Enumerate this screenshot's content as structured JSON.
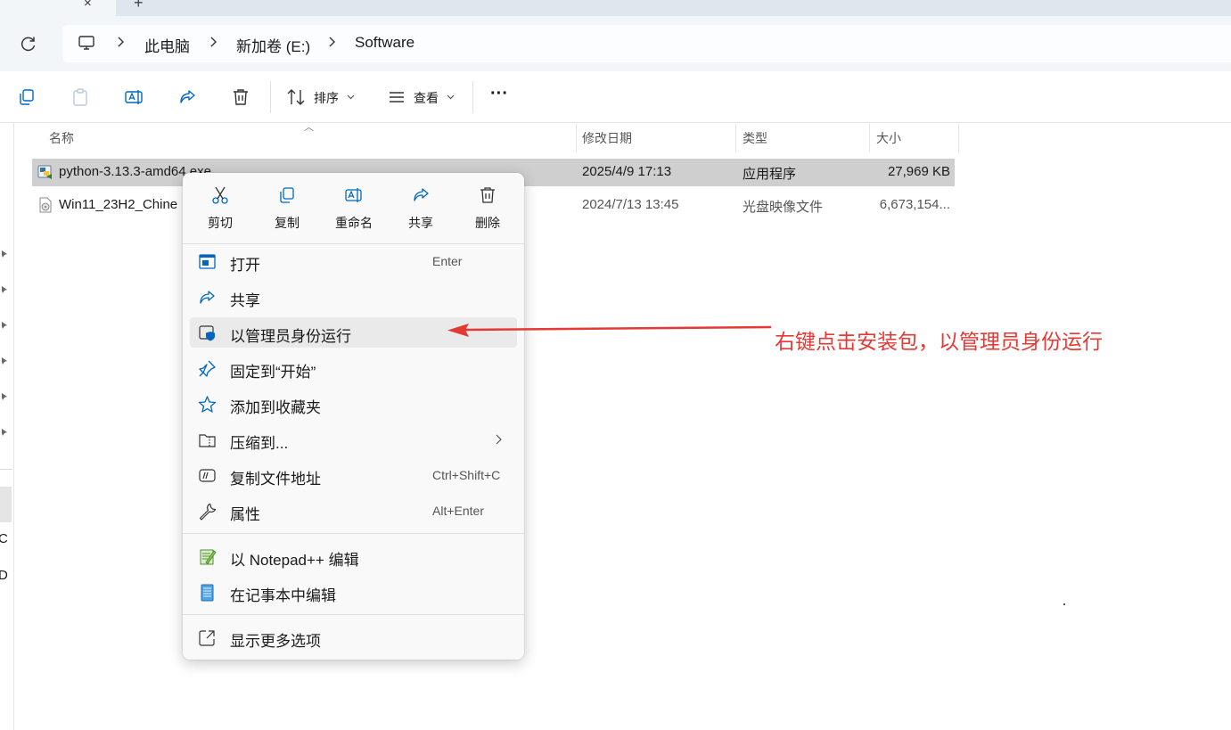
{
  "tab": {
    "close_glyph": "×",
    "new_glyph": "+"
  },
  "breadcrumb": [
    "此电脑",
    "新加卷 (E:)",
    "Software"
  ],
  "toolbar": {
    "sort_label": "排序",
    "view_label": "查看",
    "more_glyph": "···"
  },
  "columns": {
    "name": "名称",
    "modified": "修改日期",
    "type": "类型",
    "size": "大小"
  },
  "files": [
    {
      "name": "python-3.13.3-amd64.exe",
      "modified": "2025/4/9 17:13",
      "type": "应用程序",
      "size": "27,969 KB",
      "icon": "python-installer-icon",
      "selected": true
    },
    {
      "name": "Win11_23H2_Chine",
      "modified": "2024/7/13 13:45",
      "type": "光盘映像文件",
      "size": "6,673,154...",
      "icon": "disc-image-icon",
      "selected": false
    }
  ],
  "left_pane": {
    "fragment_1": "C",
    "fragment_2": "D"
  },
  "context_menu": {
    "quick_actions": [
      {
        "label": "剪切",
        "icon": "scissors-icon"
      },
      {
        "label": "复制",
        "icon": "copy-icon"
      },
      {
        "label": "重命名",
        "icon": "rename-icon"
      },
      {
        "label": "共享",
        "icon": "share-icon"
      },
      {
        "label": "删除",
        "icon": "trash-icon"
      }
    ],
    "items": [
      {
        "label": "打开",
        "accel": "Enter",
        "icon": "open-icon"
      },
      {
        "label": "共享",
        "accel": "",
        "icon": "share-icon"
      },
      {
        "label": "以管理员身份运行",
        "accel": "",
        "icon": "run-as-admin-icon"
      },
      {
        "label": "固定到“开始”",
        "accel": "",
        "icon": "pin-icon"
      },
      {
        "label": "添加到收藏夹",
        "accel": "",
        "icon": "star-icon"
      },
      {
        "label": "压缩到...",
        "accel": "",
        "icon": "zip-folder-icon"
      },
      {
        "label": "复制文件地址",
        "accel": "Ctrl+Shift+C",
        "icon": "copy-path-icon"
      },
      {
        "label": "属性",
        "accel": "Alt+Enter",
        "icon": "wrench-icon"
      },
      {
        "label": "以 Notepad++ 编辑",
        "accel": "",
        "icon": "notepadpp-icon"
      },
      {
        "label": "在记事本中编辑",
        "accel": "",
        "icon": "notepad-icon"
      },
      {
        "label": "显示更多选项",
        "accel": "",
        "icon": "more-options-icon"
      }
    ]
  },
  "annotation": {
    "text": "右键点击安装包，以管理员身份运行",
    "color": "#e53935"
  },
  "colors": {
    "selection": "#cfcfcf",
    "nav_bg": "#f3f6f9",
    "accent": "#0067c0",
    "annotation_red": "#e53935"
  }
}
